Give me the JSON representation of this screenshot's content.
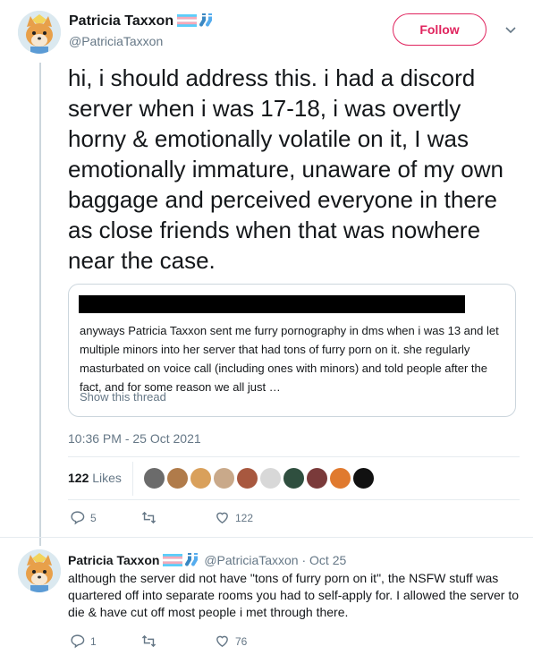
{
  "tweet": {
    "display_name": "Patricia Taxxon",
    "handle": "@PatriciaTaxxon",
    "follow_label": "Follow",
    "text": "hi, i should address this. i had a discord server when i was 17-18, i was overtly horny & emotionally volatile on it, I was emotionally immature, unaware of my own baggage and perceived everyone in there as close friends when that was nowhere near the case.",
    "timestamp": "10:36 PM - 25 Oct 2021",
    "likes_count": "122",
    "likes_label": "Likes",
    "reply_count": "5",
    "retweet_count": "",
    "like_count": "122"
  },
  "quote": {
    "text": "anyways Patricia Taxxon sent me furry pornography in dms when i was 13 and let multiple minors into her server that had tons of furry porn on it. she regularly masturbated on voice call (including ones with minors) and told people after the fact, and for some reason we all just …",
    "show_thread": "Show this thread"
  },
  "reply": {
    "display_name": "Patricia Taxxon",
    "handle_date": "@PatriciaTaxxon · Oct 25",
    "text": "although the server did not have \"tons of furry porn on it\", the NSFW stuff was quartered off into separate rooms you had to self-apply for. I allowed the server to die & have cut off most people i met through there.",
    "reply_count": "1",
    "retweet_count": "",
    "like_count": "76"
  },
  "colors": {
    "follow": "#e0245e",
    "secondary_text": "#657786",
    "border": "#ccd6dd"
  },
  "icons": [
    "trans-flag-icon",
    "socks-icon",
    "chevron-down-icon",
    "reply-icon",
    "retweet-icon",
    "like-icon"
  ]
}
